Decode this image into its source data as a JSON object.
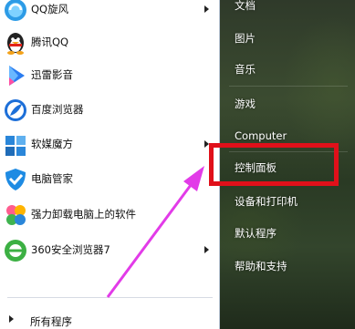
{
  "start_menu": {
    "programs": [
      {
        "label": "QQ旋风",
        "icon": "qq-xuanfeng-icon",
        "has_submenu": true
      },
      {
        "label": "腾讯QQ",
        "icon": "qq-penguin-icon",
        "has_submenu": false
      },
      {
        "label": "迅雷影音",
        "icon": "xunlei-player-icon",
        "has_submenu": false
      },
      {
        "label": "百度浏览器",
        "icon": "baidu-browser-icon",
        "has_submenu": false
      },
      {
        "label": "软媒魔方",
        "icon": "ruanmei-mofang-icon",
        "has_submenu": true
      },
      {
        "label": "电脑管家",
        "icon": "tencent-pc-manager-icon",
        "has_submenu": false
      },
      {
        "label": "强力卸载电脑上的软件",
        "icon": "uninstall-flower-icon",
        "has_submenu": false
      },
      {
        "label": "360安全浏览器7",
        "icon": "360-browser-icon",
        "has_submenu": true
      }
    ],
    "all_programs_label": "所有程序",
    "right_items": [
      {
        "label": "文档"
      },
      {
        "label": "图片"
      },
      {
        "label": "音乐"
      },
      {
        "label": "游戏"
      },
      {
        "label": "Computer"
      },
      {
        "label": "控制面板"
      },
      {
        "label": "设备和打印机"
      },
      {
        "label": "默认程序"
      },
      {
        "label": "帮助和支持"
      }
    ]
  },
  "annotation": {
    "highlight_color": "#e0101a",
    "arrow_color": "#e23be8",
    "highlighted_item": "控制面板"
  }
}
